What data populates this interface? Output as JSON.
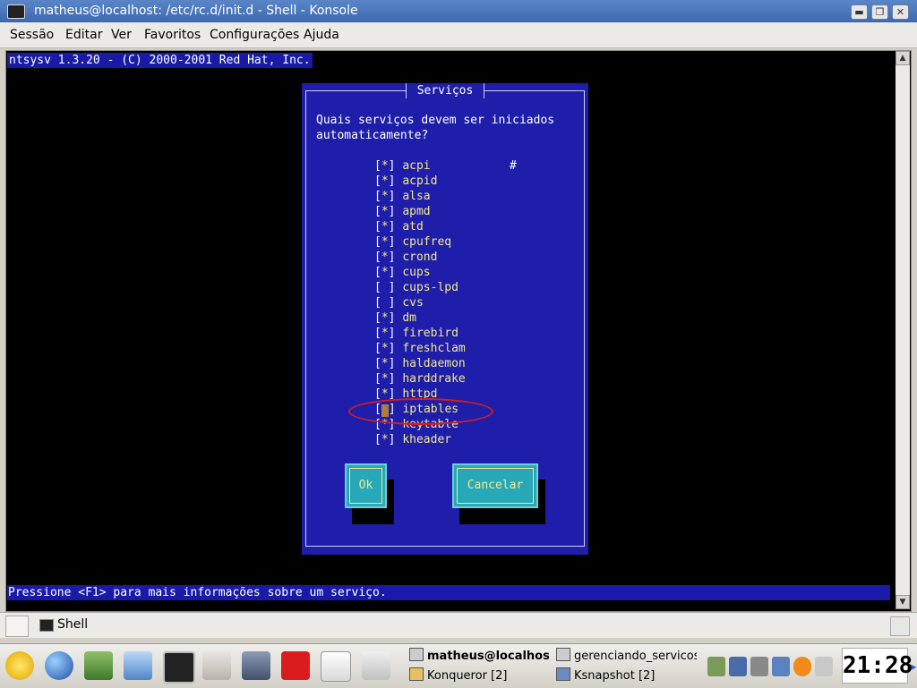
{
  "window": {
    "title": "matheus@localhost: /etc/rc.d/init.d - Shell - Konsole"
  },
  "menubar": [
    "Sessão",
    "Editar",
    "Ver",
    "Favoritos",
    "Configurações",
    "Ajuda"
  ],
  "terminal": {
    "header": "ntsysv 1.3.20 - (C) 2000-2001 Red Hat, Inc.",
    "status": "Pressione <F1> para mais informações sobre um serviço."
  },
  "dialog": {
    "title": "Serviços",
    "prompt_line1": "Quais serviços devem ser iniciados",
    "prompt_line2": "automaticamente?",
    "scroll_marker": "#",
    "services": [
      {
        "mark": "*",
        "name": "acpi"
      },
      {
        "mark": "*",
        "name": "acpid"
      },
      {
        "mark": "*",
        "name": "alsa"
      },
      {
        "mark": "*",
        "name": "apmd"
      },
      {
        "mark": "*",
        "name": "atd"
      },
      {
        "mark": "*",
        "name": "cpufreq"
      },
      {
        "mark": "*",
        "name": "crond"
      },
      {
        "mark": "*",
        "name": "cups"
      },
      {
        "mark": " ",
        "name": "cups-lpd"
      },
      {
        "mark": " ",
        "name": "cvs"
      },
      {
        "mark": "*",
        "name": "dm"
      },
      {
        "mark": "*",
        "name": "firebird"
      },
      {
        "mark": "*",
        "name": "freshclam"
      },
      {
        "mark": "*",
        "name": "haldaemon"
      },
      {
        "mark": "*",
        "name": "harddrake"
      },
      {
        "mark": "*",
        "name": "httpd"
      },
      {
        "mark": " ",
        "name": "iptables"
      },
      {
        "mark": "*",
        "name": "keytable"
      },
      {
        "mark": "*",
        "name": "kheader"
      }
    ],
    "ok_label": "Ok",
    "cancel_label": "Cancelar"
  },
  "konsole_tab": {
    "label": "Shell"
  },
  "taskbar": {
    "tasks": [
      {
        "label": "matheus@localhost",
        "icon": "terminal-icon"
      },
      {
        "label": "gerenciando_servicos",
        "icon": "editor-icon"
      },
      {
        "label": "Konqueror [2]",
        "icon": "folder-icon"
      },
      {
        "label": "Ksnapshot [2]",
        "icon": "camera-icon"
      }
    ],
    "clock": "21:28"
  }
}
